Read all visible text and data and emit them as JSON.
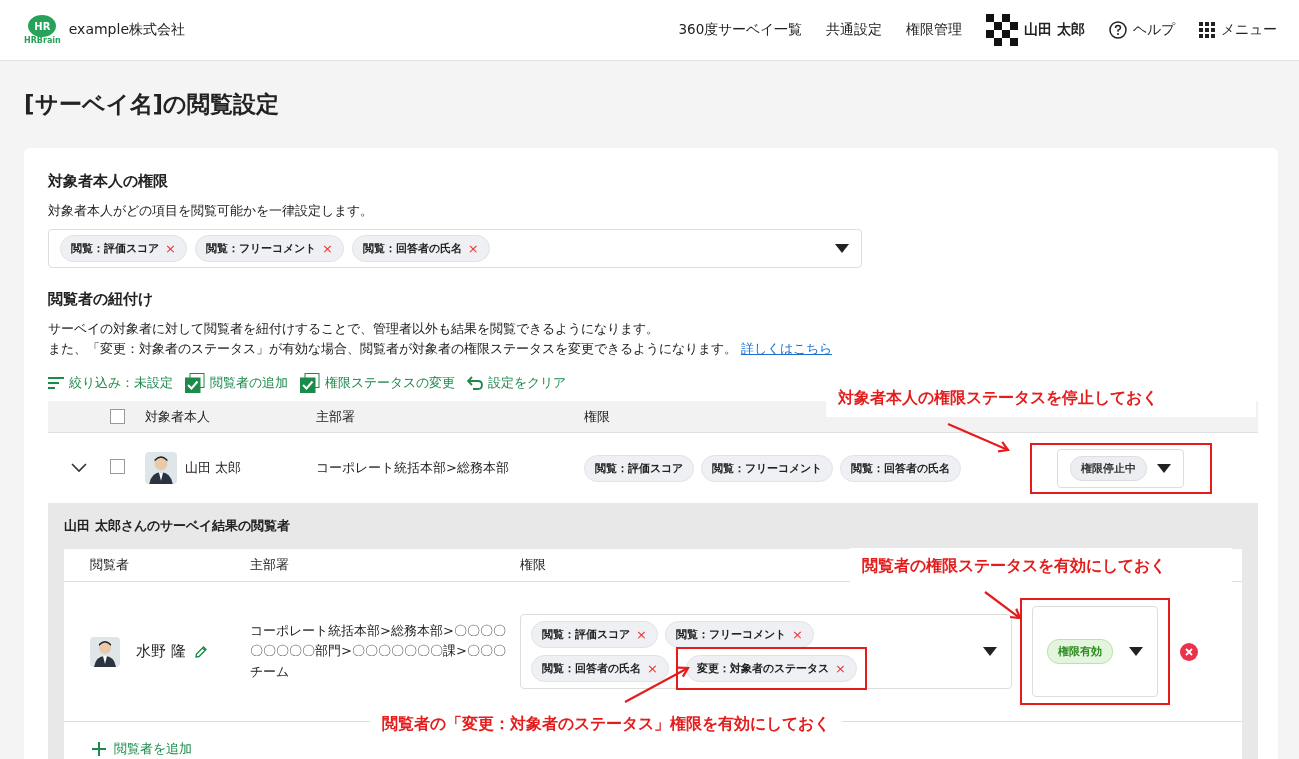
{
  "header": {
    "logo_mark": "HR",
    "logo_sub": "HRBrain",
    "company": "example株式会社",
    "nav": [
      "360度サーベイ一覧",
      "共通設定",
      "権限管理"
    ],
    "user": "山田 太郎",
    "help": "ヘルプ",
    "menu": "メニュー"
  },
  "page_title": "[サーベイ名]の閲覧設定",
  "self_permissions": {
    "title": "対象者本人の権限",
    "description": "対象者本人がどの項目を閲覧可能かを一律設定します。",
    "tags": [
      {
        "label": "閲覧：評価スコア",
        "remove": "×"
      },
      {
        "label": "閲覧：フリーコメント",
        "remove": "×"
      },
      {
        "label": "閲覧：回答者の氏名",
        "remove": "×"
      }
    ]
  },
  "viewer_link": {
    "title": "閲覧者の紐付け",
    "line1": "サーベイの対象者に対して閲覧者を紐付けすることで、管理者以外も結果を閲覧できるようになります。",
    "line2": "また、「変更：対象者のステータス」が有効な場合、閲覧者が対象者の権限ステータスを変更できるようになります。",
    "link": "詳しくはこちら"
  },
  "toolbar": [
    {
      "kind": "filter",
      "label": "絞り込み：未設定"
    },
    {
      "kind": "toggle",
      "label": "閲覧者の追加",
      "checked": true
    },
    {
      "kind": "toggle",
      "label": "権限ステータスの変更",
      "checked": true
    },
    {
      "kind": "clear",
      "label": "設定をクリア"
    }
  ],
  "table": {
    "columns": [
      "対象者本人",
      "主部署",
      "権限"
    ],
    "all_checked": false,
    "rows": [
      {
        "name": "山田 太郎",
        "department": "コーポレート統括本部>総務本部",
        "expanded": true,
        "checked": false,
        "permissions": [
          "閲覧：評価スコア",
          "閲覧：フリーコメント",
          "閲覧：回答者の氏名"
        ],
        "status": {
          "kind": "stopped",
          "label": "権限停止中",
          "highlighted": true
        }
      }
    ]
  },
  "viewers": {
    "title": "山田 太郎さんのサーベイ結果の閲覧者",
    "columns": [
      "閲覧者",
      "主部署",
      "権限"
    ],
    "rows": [
      {
        "name": "水野 隆",
        "department": "コーポレート統括本部>総務本部>〇〇〇〇〇〇〇〇〇部門>〇〇〇〇〇〇〇課>〇〇〇チーム",
        "permissions": [
          {
            "label": "閲覧：評価スコア",
            "remove": "×",
            "highlighted": false
          },
          {
            "label": "閲覧：フリーコメント",
            "remove": "×",
            "highlighted": false
          },
          {
            "label": "閲覧：回答者の氏名",
            "remove": "×",
            "highlighted": false
          },
          {
            "label": "変更：対象者のステータス",
            "remove": "×",
            "highlighted": true
          }
        ],
        "status": {
          "kind": "active",
          "label": "権限有効",
          "highlighted": true
        }
      }
    ],
    "add_label": "閲覧者を追加"
  },
  "annotations": [
    {
      "text": "対象者本人の権限ステータスを停止しておく"
    },
    {
      "text": "閲覧者の権限ステータスを有効にしておく"
    },
    {
      "text": "閲覧者の「変更：対象者のステータス」権限を有効にしておく"
    }
  ]
}
